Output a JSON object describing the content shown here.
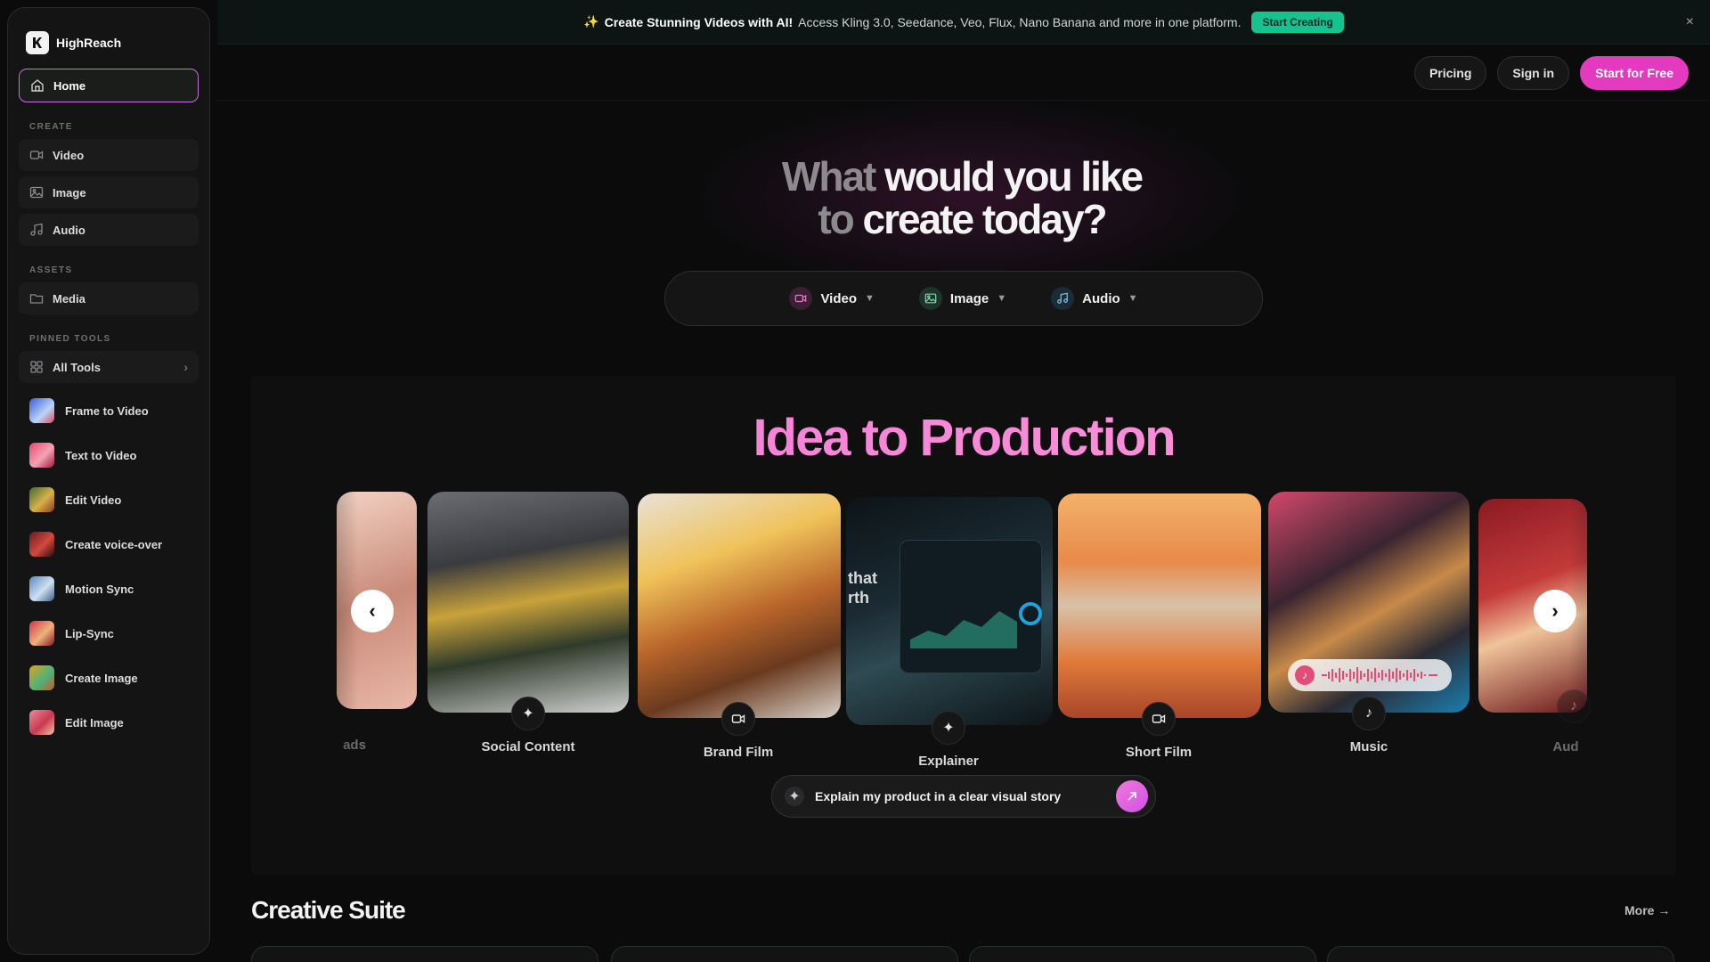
{
  "brand": {
    "name": "HighReach"
  },
  "sidebar": {
    "home_label": "Home",
    "create_label": "CREATE",
    "create_items": [
      {
        "label": "Video"
      },
      {
        "label": "Image"
      },
      {
        "label": "Audio"
      }
    ],
    "assets_label": "ASSETS",
    "assets_items": [
      {
        "label": "Media"
      }
    ],
    "pinned_label": "PINNED TOOLS",
    "all_tools_label": "All Tools",
    "tools": [
      {
        "label": "Frame to Video"
      },
      {
        "label": "Text to Video"
      },
      {
        "label": "Edit Video"
      },
      {
        "label": "Create voice-over"
      },
      {
        "label": "Motion Sync"
      },
      {
        "label": "Lip-Sync"
      },
      {
        "label": "Create Image"
      },
      {
        "label": "Edit Image"
      }
    ]
  },
  "banner": {
    "headline": "Create Stunning Videos with AI!",
    "text": "Access Kling 3.0, Seedance, Veo, Flux, Nano Banana and more in one platform.",
    "cta": "Start Creating",
    "close": "×"
  },
  "header": {
    "pricing": "Pricing",
    "sign_in": "Sign in",
    "start": "Start for Free"
  },
  "hero": {
    "line1_dim": "What",
    "line1_rest": "would you like",
    "line2_dim": "to",
    "line2_rest": "create today?",
    "types": [
      {
        "label": "Video"
      },
      {
        "label": "Image"
      },
      {
        "label": "Audio"
      }
    ]
  },
  "showcase": {
    "title": "Idea to Production",
    "cards": [
      {
        "label": "ads"
      },
      {
        "label": "Social Content"
      },
      {
        "label": "Brand Film"
      },
      {
        "label": "Explainer"
      },
      {
        "label": "Short Film"
      },
      {
        "label": "Music"
      },
      {
        "label": "Aud"
      }
    ],
    "explainer_overlay": "that\nrth",
    "prompt": "Explain my product in a clear visual story"
  },
  "suite": {
    "title": "Creative Suite",
    "more": "More"
  },
  "colors": {
    "accent": "#e43ac0",
    "banner_cta": "#16c28e",
    "home_border": "#c86fe0"
  }
}
